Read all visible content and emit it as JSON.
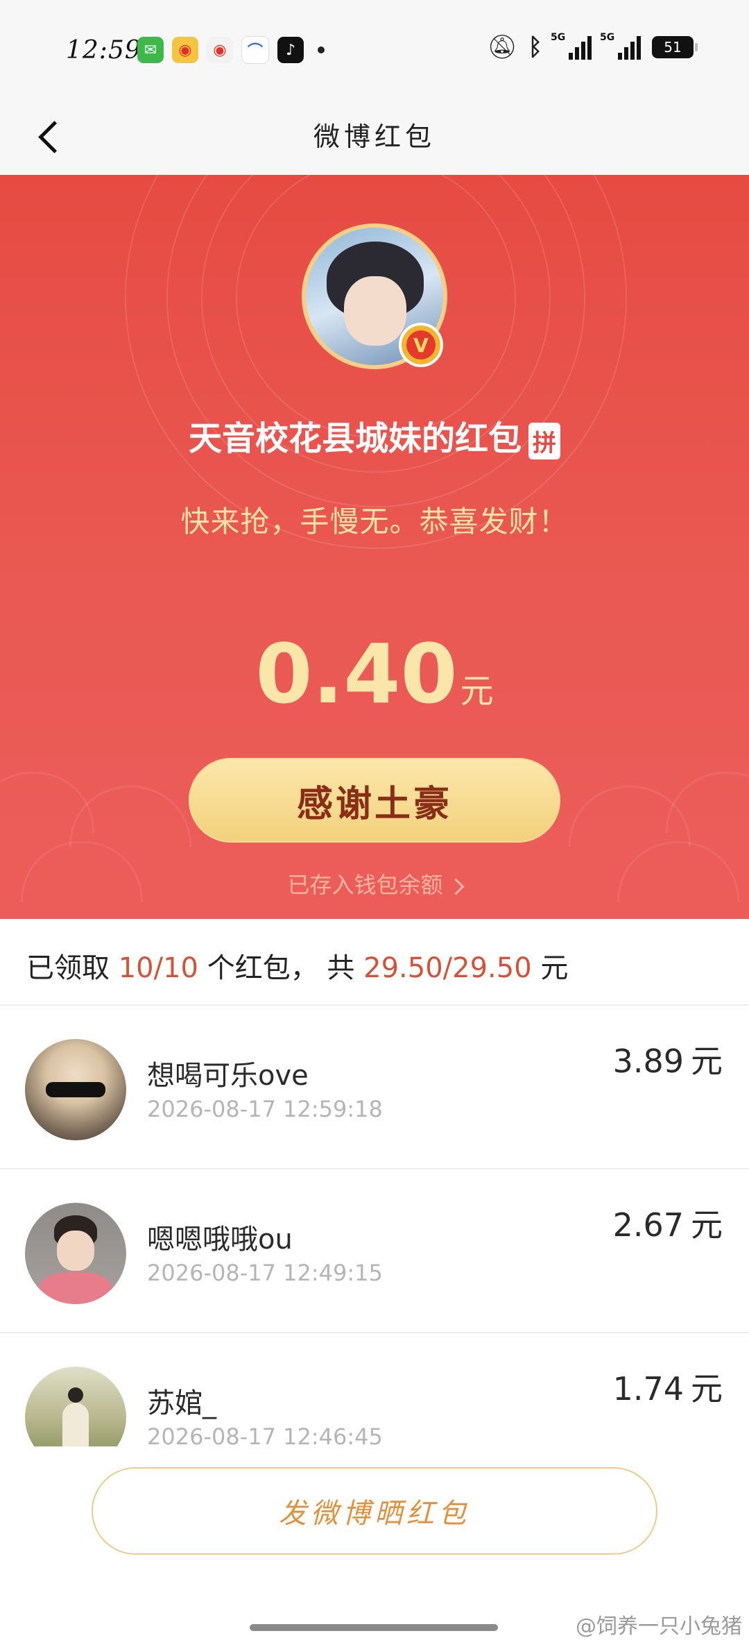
{
  "status_bar": {
    "time": "12:59",
    "apps": [
      {
        "icon": "wechat-icon",
        "color": "#3fb84b",
        "glyph": "✉"
      },
      {
        "icon": "weibo-icon",
        "color": "#f5c542",
        "glyph": "◉"
      },
      {
        "icon": "weibo-alt-icon",
        "color": "#f2f2f2",
        "glyph": "◉"
      },
      {
        "icon": "taobao-icon",
        "color": "#ffffff",
        "glyph": "⌒"
      },
      {
        "icon": "tiktok-icon",
        "color": "#111111",
        "glyph": "♪"
      }
    ],
    "signal_label_1": "5G",
    "signal_label_2": "5G",
    "battery": "51"
  },
  "header": {
    "title": "微博红包"
  },
  "red_packet": {
    "sender": "天音校花县城妹的红包",
    "sender_badge": "拼",
    "greeting": "快来抢，手慢无。恭喜发财！",
    "amount": "0.40",
    "amount_unit": "元",
    "thanks_button": "感谢土豪",
    "wallet_link": "已存入钱包余额"
  },
  "summary": {
    "prefix": "已领取 ",
    "count": "10/10",
    "middle": " 个红包， 共 ",
    "total": "29.50/29.50",
    "suffix": " 元"
  },
  "recipients": [
    {
      "name": "想喝可乐ove",
      "time": "2026-08-17 12:59:18",
      "amount": "3.89",
      "unit": "元"
    },
    {
      "name": "嗯嗯哦哦ou",
      "time": "2026-08-17 12:49:15",
      "amount": "2.67",
      "unit": "元"
    },
    {
      "name": "苏婠_",
      "time": "2026-08-17 12:46:45",
      "amount": "1.74",
      "unit": "元"
    }
  ],
  "footer": {
    "send_button": "发微博晒红包",
    "watermark": "@饲养一只小兔猪"
  },
  "colors": {
    "hero_red": "#e64b43",
    "gold_text": "#fbe6a9",
    "highlight": "#d0533a",
    "button_text": "#8a2d16"
  }
}
